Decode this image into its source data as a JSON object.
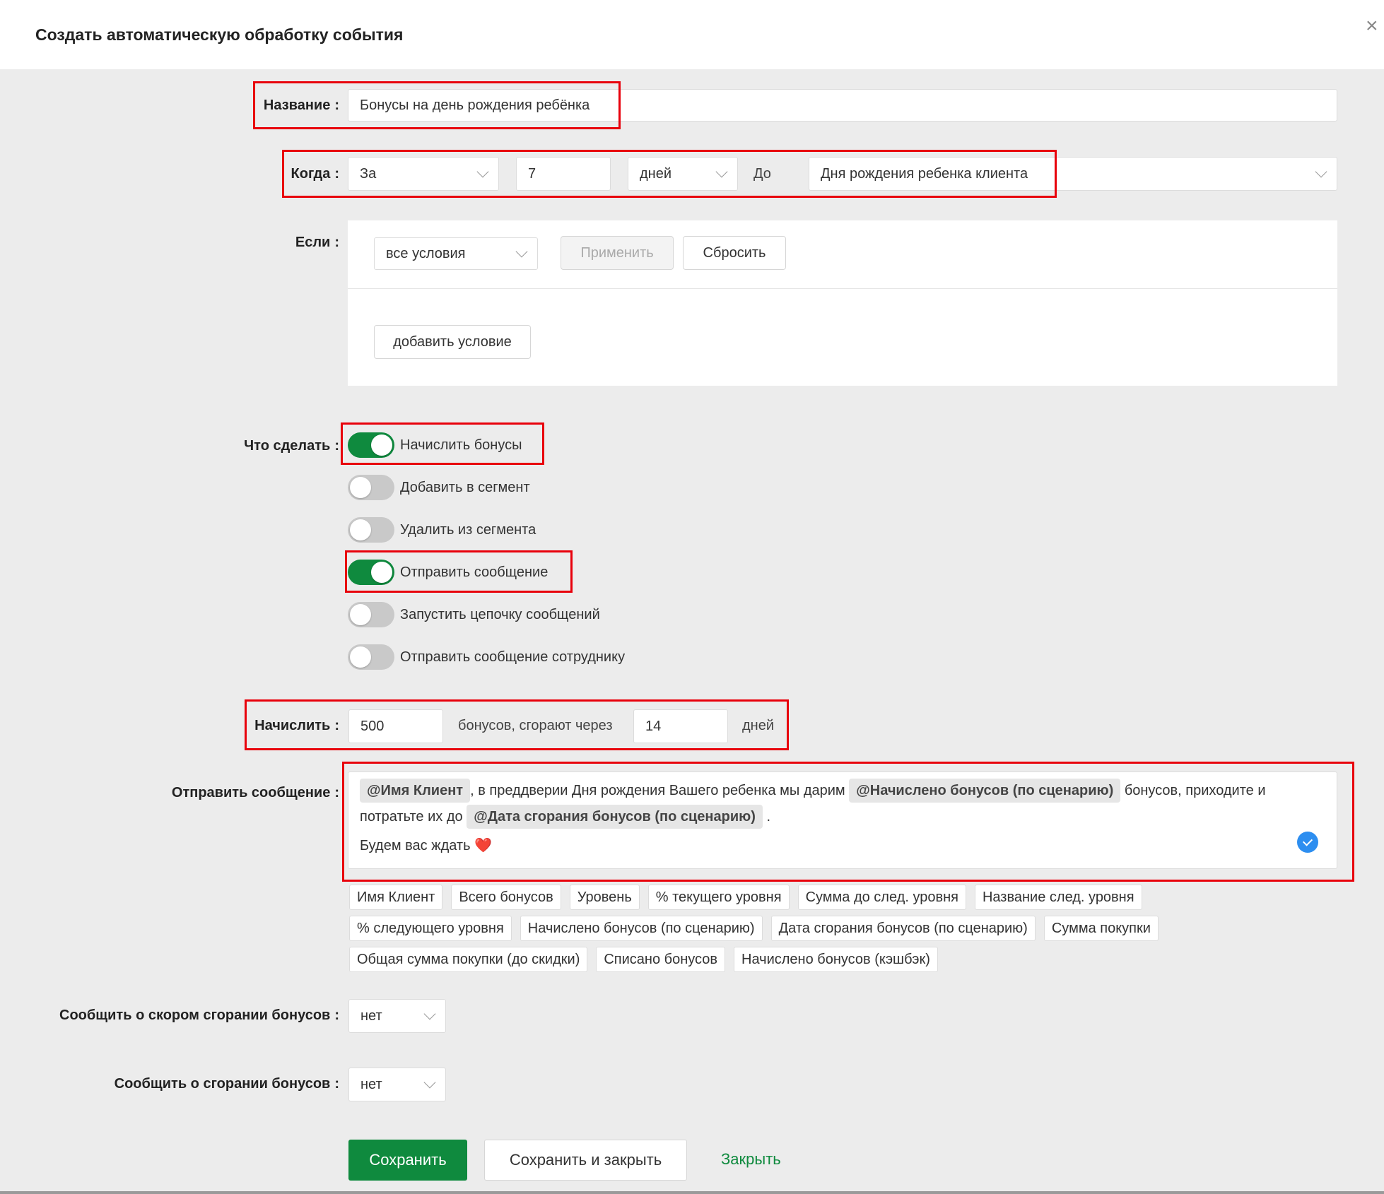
{
  "header": {
    "title": "Создать автоматическую обработку события",
    "close_symbol": "×"
  },
  "form": {
    "name": {
      "label": "Название",
      "value": "Бонусы на день рождения ребёнка"
    },
    "when": {
      "label": "Когда",
      "direction": "За",
      "amount": "7",
      "unit": "дней",
      "relation": "До",
      "event": "Дня рождения ребенка клиента"
    },
    "if": {
      "label": "Если",
      "condition_mode": "все условия",
      "apply_label": "Применить",
      "reset_label": "Сбросить",
      "add_condition_label": "добавить условие"
    },
    "actions": {
      "label": "Что сделать",
      "items": [
        {
          "label": "Начислить бонусы",
          "enabled": true
        },
        {
          "label": "Добавить в сегмент",
          "enabled": false
        },
        {
          "label": "Удалить из сегмента",
          "enabled": false
        },
        {
          "label": "Отправить сообщение",
          "enabled": true
        },
        {
          "label": "Запустить цепочку сообщений",
          "enabled": false
        },
        {
          "label": "Отправить сообщение сотруднику",
          "enabled": false
        }
      ]
    },
    "accrue": {
      "label": "Начислить",
      "amount": "500",
      "middle_text": "бонусов, сгорают через",
      "days": "14",
      "days_suffix": "дней"
    },
    "message": {
      "label": "Отправить сообщение",
      "chip_client": "@Имя Клиент",
      "text1": ", в преддверии Дня рождения Вашего ребенка мы дарим",
      "chip_accrued": "@Начислено бонусов (по сценарию)",
      "text2": "бонусов, приходите и потратьте их до",
      "chip_expiry": "@Дата сгорания бонусов (по сценарию)",
      "text3": ".",
      "line2": "Будем вас ждать",
      "heart": "❤️"
    },
    "variables": [
      [
        "Имя Клиент",
        "Всего бонусов",
        "Уровень",
        "% текущего уровня",
        "Сумма до след. уровня",
        "Название след. уровня"
      ],
      [
        "% следующего уровня",
        "Начислено бонусов (по сценарию)",
        "Дата сгорания бонусов (по сценарию)",
        "Сумма покупки"
      ],
      [
        "Общая сумма покупки (до скидки)",
        "Списано бонусов",
        "Начислено бонусов (кэшбэк)"
      ]
    ],
    "notify_soon": {
      "label": "Сообщить о скором сгорании бонусов",
      "value": "нет"
    },
    "notify_expired": {
      "label": "Сообщить о сгорании бонусов",
      "value": "нет"
    }
  },
  "footer": {
    "save_label": "Сохранить",
    "save_close_label": "Сохранить и закрыть",
    "close_label": "Закрыть"
  },
  "colors": {
    "accent_green": "#0f8a3e",
    "highlight_red": "#e8000b",
    "check_blue": "#2d8ef0"
  }
}
